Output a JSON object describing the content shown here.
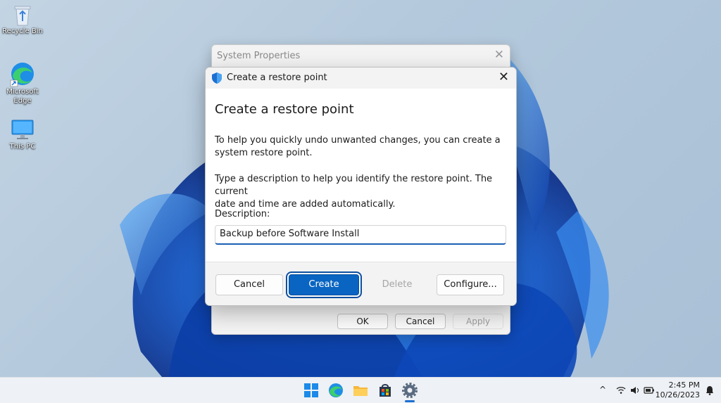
{
  "desktop": {
    "icons": [
      {
        "name": "recycle-bin-icon",
        "label": "Recycle Bin"
      },
      {
        "name": "edge-icon",
        "label": "Microsoft Edge"
      },
      {
        "name": "this-pc-icon",
        "label": "This PC"
      }
    ]
  },
  "system_properties": {
    "title": "System Properties",
    "buttons": {
      "ok": "OK",
      "cancel": "Cancel",
      "apply": "Apply"
    }
  },
  "dialog": {
    "title": "Create a restore point",
    "heading": "Create a restore point",
    "para1_line1": "To help you quickly undo unwanted changes, you can create a",
    "para1_line2": "system restore point.",
    "para2_line1": "Type a description to help you identify the restore point. The current",
    "para2_line2": "date and time are added automatically.",
    "description_label": "Description:",
    "description_value": "Backup before Software Install",
    "buttons": {
      "cancel": "Cancel",
      "create": "Create",
      "delete": "Delete",
      "configure": "Configure..."
    }
  },
  "taskbar": {
    "icons": [
      "start-icon",
      "edge-icon",
      "file-explorer-icon",
      "microsoft-store-icon",
      "settings-icon"
    ],
    "tray": {
      "chevron": "^"
    },
    "clock": {
      "time": "2:45 PM",
      "date": "10/26/2023"
    }
  },
  "colors": {
    "accent": "#0a64c2",
    "focus_ring": "#0f4fa0"
  }
}
